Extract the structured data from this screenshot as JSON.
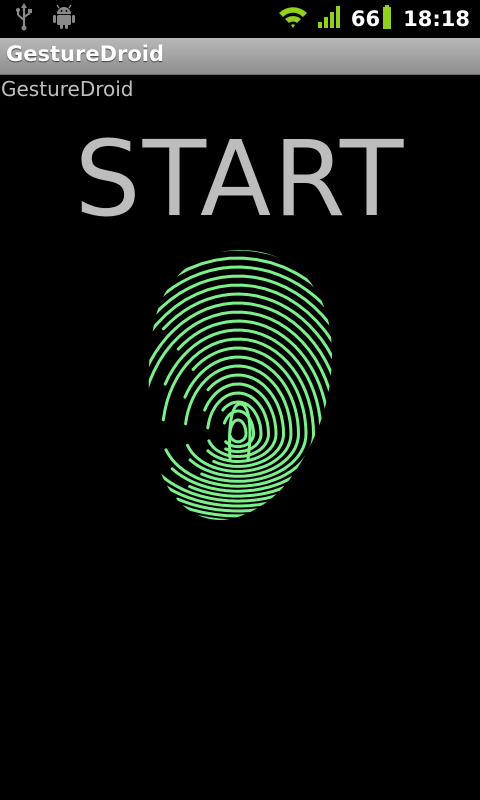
{
  "status_bar": {
    "icons": [
      "usb-icon",
      "android-debug-icon",
      "wifi-icon",
      "signal-icon",
      "battery-icon"
    ],
    "battery_level": "66",
    "time": "18:18"
  },
  "title_bar": {
    "title": "GestureDroid"
  },
  "main": {
    "app_label": "GestureDroid",
    "start_label": "START",
    "fingerprint_icon": "fingerprint-icon",
    "fingerprint_color": "#7cf08a"
  },
  "colors": {
    "background": "#000000",
    "title_bar": "#a4a4a4",
    "signal_green": "#8fd021"
  }
}
